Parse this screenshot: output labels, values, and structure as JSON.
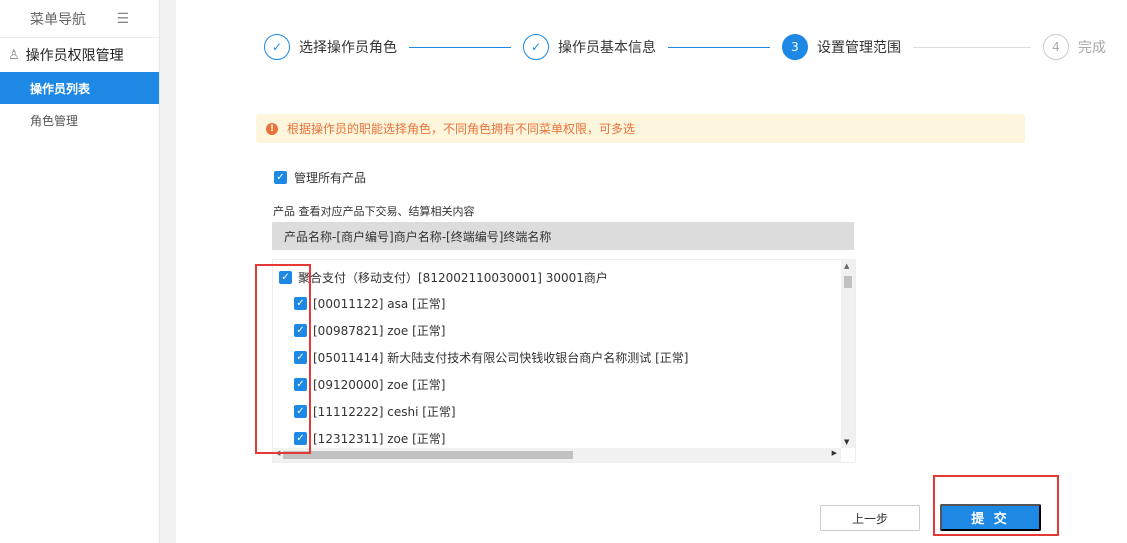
{
  "sidebar": {
    "header": "菜单导航",
    "toggle_icon": "menu-fold-icon",
    "group_title": "操作员权限管理",
    "items": [
      {
        "label": "操作员列表",
        "active": true
      },
      {
        "label": "角色管理",
        "active": false
      }
    ]
  },
  "steps": [
    {
      "marker": "✓",
      "label": "选择操作员角色",
      "state": "done"
    },
    {
      "marker": "✓",
      "label": "操作员基本信息",
      "state": "done"
    },
    {
      "marker": "3",
      "label": "设置管理范围",
      "state": "current"
    },
    {
      "marker": "4",
      "label": "完成",
      "state": "pending"
    }
  ],
  "alert": {
    "icon": "!",
    "text": "根据操作员的职能选择角色，不同角色拥有不同菜单权限，可多选"
  },
  "manage_all": {
    "label": "管理所有产品",
    "checked": true
  },
  "product_caption": "产品 查看对应产品下交易、结算相关内容",
  "column_header": "产品名称-[商户编号]商户名称-[终端编号]终端名称",
  "tree": {
    "root": {
      "label": "聚合支付（移动支付）[812002110030001] 30001商户",
      "checked": true
    },
    "children": [
      {
        "label": "[00011122] asa [正常]",
        "checked": true
      },
      {
        "label": "[00987821] zoe [正常]",
        "checked": true
      },
      {
        "label": "[05011414] 新大陆支付技术有限公司快钱收银台商户名称测试 [正常]",
        "checked": true
      },
      {
        "label": "[09120000] zoe [正常]",
        "checked": true
      },
      {
        "label": "[11112222] ceshi [正常]",
        "checked": true
      },
      {
        "label": "[12312311] zoe [正常]",
        "checked": true
      }
    ]
  },
  "buttons": {
    "prev": "上一步",
    "submit": "提 交"
  },
  "colors": {
    "primary": "#1e88e5",
    "highlight": "#e53935",
    "alert_bg": "#fdf6dd",
    "alert_text": "#e8733a"
  }
}
